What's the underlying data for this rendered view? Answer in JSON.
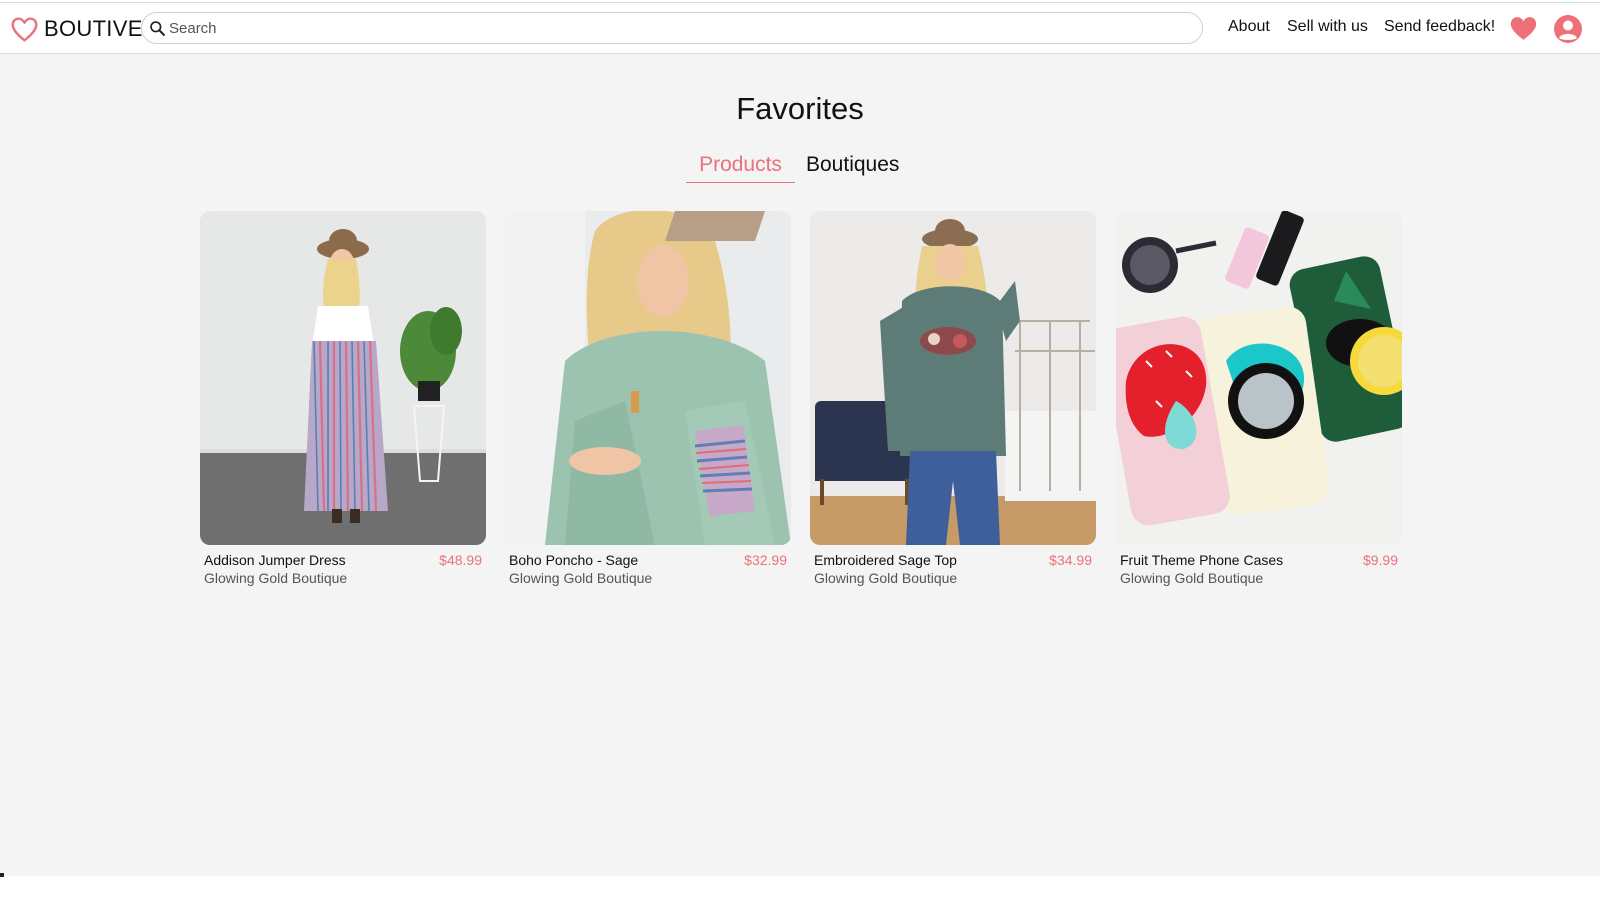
{
  "header": {
    "brand": "BOUTIVE",
    "search_placeholder": "Search",
    "nav": {
      "about": "About",
      "sell": "Sell with us",
      "feedback": "Send feedback!"
    }
  },
  "colors": {
    "accent": "#e9737b",
    "background": "#f4f4f4",
    "text": "#111111"
  },
  "icons": {
    "brand": "heart-outline-icon",
    "search": "search-icon",
    "favorites": "heart-filled-icon",
    "profile": "user-circle-icon"
  },
  "main": {
    "title": "Favorites",
    "tabs": [
      {
        "label": "Products",
        "active": true
      },
      {
        "label": "Boutiques",
        "active": false
      }
    ],
    "products": [
      {
        "name": "Addison Jumper Dress",
        "boutique": "Glowing Gold Boutique",
        "price": "$48.99"
      },
      {
        "name": "Boho Poncho - Sage",
        "boutique": "Glowing Gold Boutique",
        "price": "$32.99"
      },
      {
        "name": "Embroidered Sage Top",
        "boutique": "Glowing Gold Boutique",
        "price": "$34.99"
      },
      {
        "name": "Fruit Theme Phone Cases",
        "boutique": "Glowing Gold Boutique",
        "price": "$9.99"
      }
    ]
  }
}
